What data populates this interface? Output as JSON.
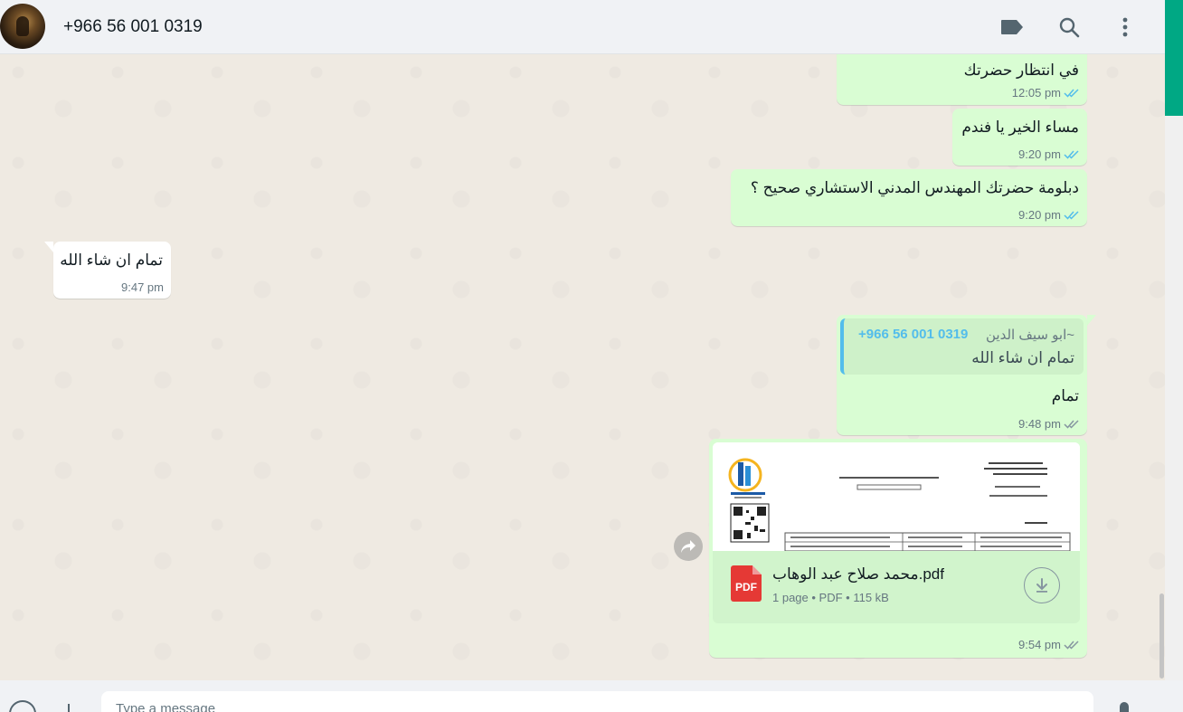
{
  "header": {
    "contact_name": "+966 56 001 0319",
    "icons": [
      "label-icon",
      "search-icon",
      "menu-icon"
    ]
  },
  "messages": [
    {
      "direction": "out",
      "text": "في انتظار حضرتك",
      "time": "12:05 pm",
      "status": "read"
    },
    {
      "direction": "out",
      "text": "مساء الخير يا فندم",
      "time": "9:20 pm",
      "status": "read"
    },
    {
      "direction": "out",
      "text": "دبلومة حضرتك المهندس المدني الاستشاري صحيح ؟",
      "time": "9:20 pm",
      "status": "read"
    },
    {
      "direction": "in",
      "text": "تمام ان شاء الله",
      "time": "9:47 pm"
    },
    {
      "direction": "out",
      "quote": {
        "author": "~ابو سيف الدين",
        "phone": "+966 56 001 0319",
        "text": "تمام ان شاء الله"
      },
      "text": "تمام",
      "time": "9:48 pm",
      "status": "delivered"
    },
    {
      "direction": "out",
      "document": {
        "name": "محمد صلاح عبد الوهاب.pdf",
        "pages": "1 page",
        "type": "PDF",
        "size": "115 kB",
        "icon_label": "PDF"
      },
      "time": "9:54 pm",
      "status": "delivered"
    }
  ],
  "footer": {
    "placeholder": "Type a message"
  },
  "colors": {
    "outgoing": "#d9fdd3",
    "incoming": "#ffffff",
    "accent": "#00a884",
    "read_tick": "#53bdeb",
    "chat_bg": "#efeae2"
  }
}
